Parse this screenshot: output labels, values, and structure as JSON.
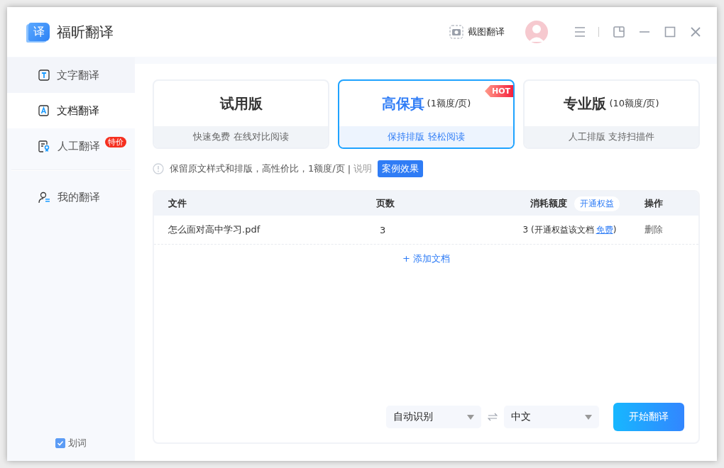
{
  "app": {
    "name": "福昕翻译",
    "logo_char": "译"
  },
  "header": {
    "screenshot_button": "截图翻译"
  },
  "sidebar": {
    "items": [
      {
        "label": "文字翻译",
        "kind": "text",
        "selected": false
      },
      {
        "label": "文档翻译",
        "kind": "doc",
        "selected": true
      },
      {
        "label": "人工翻译",
        "kind": "human",
        "selected": false,
        "badge": "特价"
      },
      {
        "label": "我的翻译",
        "kind": "mine",
        "selected": false
      }
    ],
    "word_pick": {
      "label": "划词",
      "checked": true
    }
  },
  "plans": [
    {
      "name": "试用版",
      "note": "快速免费 在线对比阅读",
      "selected": false
    },
    {
      "name": "高保真",
      "price": "(1额度/页)",
      "note": "保持排版 轻松阅读",
      "selected": true,
      "badge": "HOT"
    },
    {
      "name": "专业版",
      "price": "(10额度/页)",
      "note": "人工排版 支持扫描件",
      "selected": false
    }
  ],
  "info": {
    "text": "保留原文样式和排版，高性价比，1额度/页",
    "separator": "|",
    "link": "说明",
    "button": "案例效果"
  },
  "table": {
    "columns": [
      "文件",
      "页数",
      "消耗额度",
      "操作"
    ],
    "column_action": "开通权益",
    "rows": [
      {
        "file": "怎么面对高中学习.pdf",
        "pages": "3",
        "cost": "3 (开通权益该文档",
        "cost_link": "免费",
        "cost_end": ")",
        "action": "删除"
      }
    ],
    "add": "+ 添加文档"
  },
  "source_language": "自动识别",
  "target_language": "中文",
  "start_button": "开始翻译"
}
